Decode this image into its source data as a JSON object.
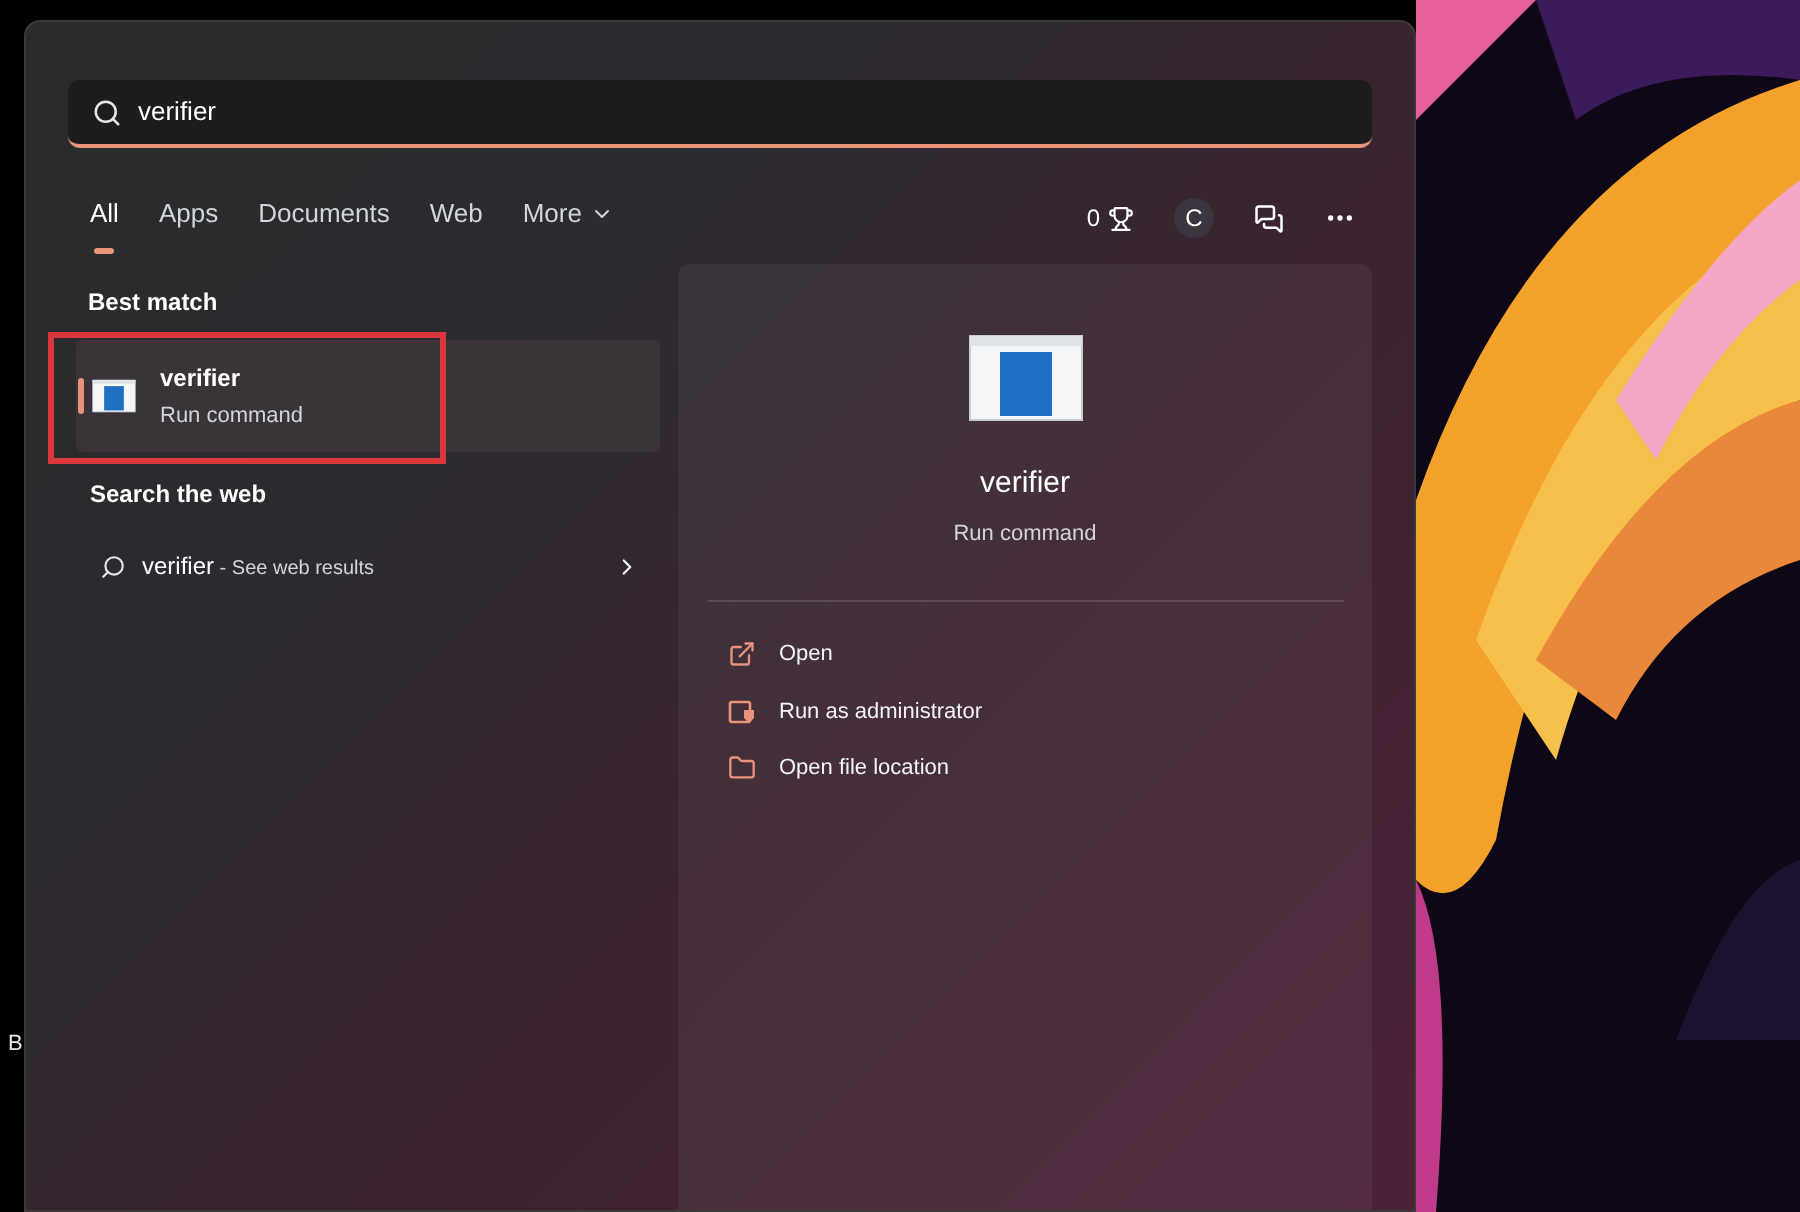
{
  "desktop": {
    "edge_label": "B"
  },
  "search": {
    "value": "verifier"
  },
  "tabs": [
    {
      "label": "All",
      "selected": true
    },
    {
      "label": "Apps",
      "selected": false
    },
    {
      "label": "Documents",
      "selected": false
    },
    {
      "label": "Web",
      "selected": false
    },
    {
      "label": "More",
      "selected": false,
      "kind": "dropdown"
    }
  ],
  "toolbar": {
    "points": "0",
    "avatar": "C"
  },
  "best_match": {
    "heading": "Best match",
    "title": "verifier",
    "subtitle": "Run command",
    "selected": true,
    "highlighted": true
  },
  "web": {
    "heading": "Search the web",
    "query": "verifier",
    "suffix": " - See web results"
  },
  "preview": {
    "title": "verifier",
    "subtitle": "Run command",
    "actions": [
      {
        "label": "Open",
        "kind": "open"
      },
      {
        "label": "Run as administrator",
        "kind": "admin"
      },
      {
        "label": "Open file location",
        "kind": "folder"
      }
    ]
  }
}
